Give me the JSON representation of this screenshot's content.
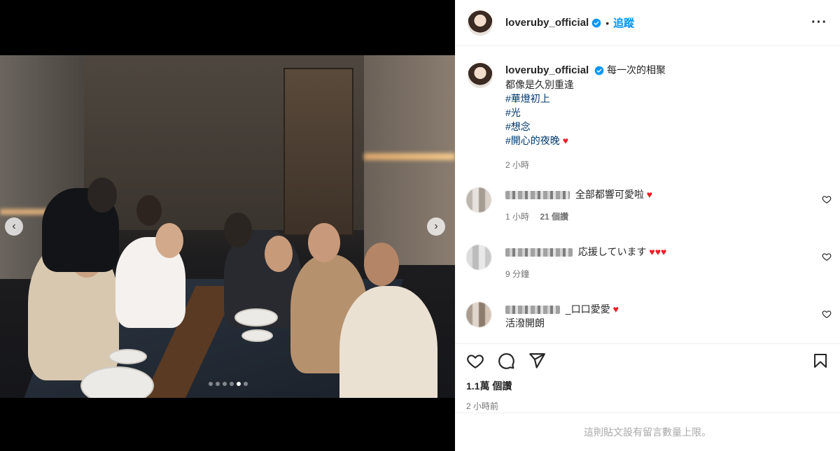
{
  "post": {
    "username": "loveruby_official",
    "follow_label": "追蹤",
    "separator": "•",
    "more_label": "···"
  },
  "caption": {
    "username": "loveruby_official",
    "line1": "每一次的相聚",
    "line2": "都像是久別重逢",
    "hashtags": [
      "#華燈初上",
      "#光",
      "#想念",
      "#開心的夜晚"
    ],
    "heart": "♥",
    "time": "2 小時"
  },
  "comments": [
    {
      "name_hidden": "********",
      "text": "全部都響可愛啦",
      "heart": "♥",
      "time": "1 小時",
      "likes": "21 個讚"
    },
    {
      "name_hidden": "*** ******",
      "text": "応援しています",
      "hearts": "♥♥♥",
      "time": "9 分鐘"
    },
    {
      "name_hidden": "************",
      "text": "_口口愛愛",
      "heart": "♥",
      "text2": "活潑開朗"
    }
  ],
  "actions": {
    "views": "1.1萬 個讚",
    "posted": "2 小時前"
  },
  "footer": {
    "limit_notice": "這則貼文設有留言數量上限。"
  },
  "carousel": {
    "prev_icon": "‹",
    "next_icon": "›",
    "slides": 6,
    "active_slide": 5
  },
  "colors": {
    "link": "#0095f6",
    "hashtag": "#00376b",
    "verified": "#0095f6",
    "heart": "#ed1c24"
  }
}
